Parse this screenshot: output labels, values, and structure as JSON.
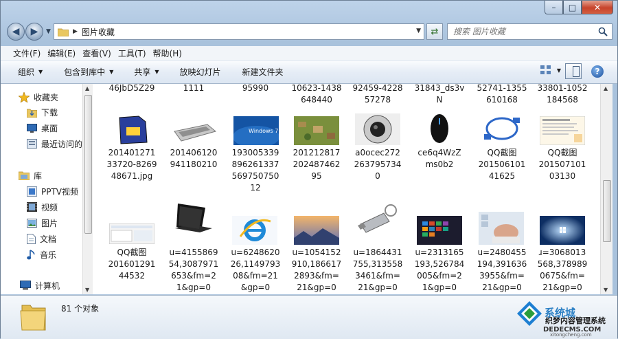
{
  "window": {
    "caption": {
      "minimize": "–",
      "maximize": "□",
      "close": "✕"
    }
  },
  "address": {
    "path": "图片收藏"
  },
  "search": {
    "placeholder": "搜索 图片收藏"
  },
  "menu": [
    "文件(F)",
    "编辑(E)",
    "查看(V)",
    "工具(T)",
    "帮助(H)"
  ],
  "toolbar": {
    "organize": "组织",
    "include": "包含到库中",
    "share": "共享",
    "slideshow": "放映幻灯片",
    "new_folder": "新建文件夹",
    "help": "?"
  },
  "nav": {
    "favorites": "收藏夹",
    "downloads": "下载",
    "desktop": "桌面",
    "recent": "最近访问的",
    "libraries": "库",
    "pptv": "PPTV视频",
    "videos": "视频",
    "pictures": "图片",
    "documents": "文档",
    "music": "音乐",
    "computer": "计算机"
  },
  "files": {
    "row0": [
      "46JbD5Z29",
      "1111",
      "95990",
      "10623-1438\n648440",
      "92459-4228\n57278",
      "31843_ds3v\nN",
      "52741-1355\n610168",
      "33801-1052\n184568"
    ],
    "row1": [
      "201401271\n33720-8269\n48671.jpg",
      "201406120\n941180210",
      "193005339\n896261337\n569750750\n12",
      "201212817\n202487462\n95",
      "a0ocec272\n263795734\n0",
      "ce6q4WzZ\nms0b2",
      "QQ截图\n201506101\n41625",
      "QQ截图\n201507101\n03130"
    ],
    "row2": [
      "QQ截图\n201601291\n44532",
      "u=4155869\n54,3087971\n653&fm=2\n1&gp=0",
      "u=6248620\n26,1149793\n08&fm=21\n&gp=0",
      "u=1054152\n910,186617\n2893&fm=\n21&gp=0",
      "u=1864431\n755,313558\n3461&fm=\n21&gp=0",
      "u=2313165\n193,526784\n005&fm=2\n1&gp=0",
      "u=2480455\n194,391636\n3955&fm=\n21&gp=0",
      "ɹ=3068013\n568,378989\n0675&fm=\n21&gp=0"
    ]
  },
  "status": {
    "count": "81 个对象"
  },
  "watermark": {
    "brand": "系统城",
    "caption": "织梦内容管理系统",
    "url": "DEDECMS.COM",
    "domain": "xitongcheng.com"
  },
  "colors": {
    "accent": "#1f5ea8",
    "close": "#c7432b"
  }
}
